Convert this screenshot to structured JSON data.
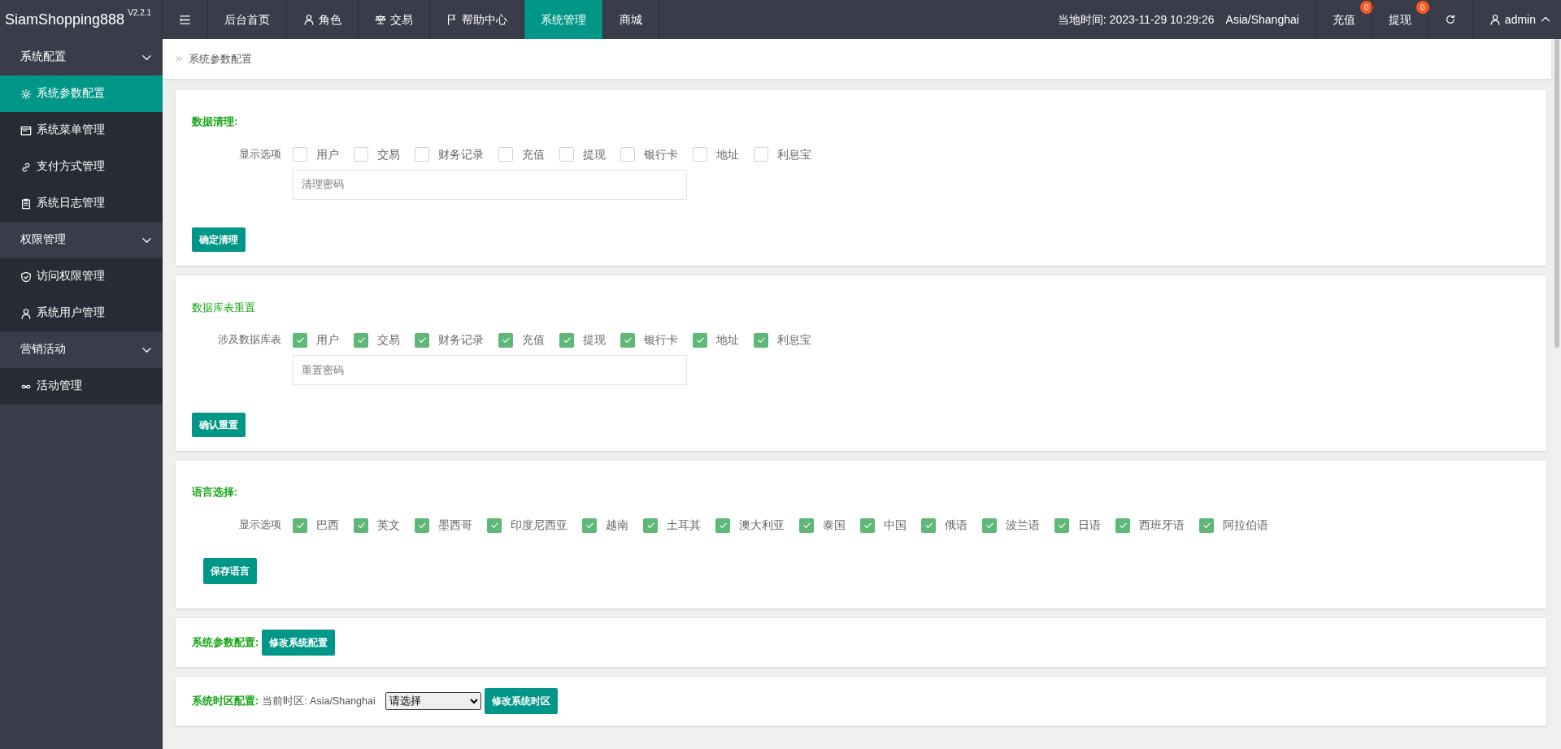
{
  "brand": {
    "name": "SiamShopping888",
    "version": "V2.2.1"
  },
  "top_nav": [
    {
      "label": "后台首页",
      "selected": false
    },
    {
      "label": "角色",
      "selected": false
    },
    {
      "label": "交易",
      "selected": false
    },
    {
      "label": "帮助中心",
      "selected": false
    },
    {
      "label": "系统管理",
      "selected": true
    },
    {
      "label": "商城",
      "selected": false
    }
  ],
  "top_right": {
    "time": "当地时间: 2023-11-29 10:29:26",
    "timezone": "Asia/Shanghai",
    "actions": [
      {
        "label": "充值",
        "badge": "0"
      },
      {
        "label": "提现",
        "badge": "0"
      }
    ],
    "user": "admin"
  },
  "sidebar": [
    {
      "label": "系统配置",
      "expanded": true,
      "children": [
        {
          "label": "系统参数配置",
          "selected": true
        },
        {
          "label": "系统菜单管理",
          "selected": false
        },
        {
          "label": "支付方式管理",
          "selected": false
        },
        {
          "label": "系统日志管理",
          "selected": false
        }
      ]
    },
    {
      "label": "权限管理",
      "expanded": true,
      "children": [
        {
          "label": "访问权限管理",
          "selected": false
        },
        {
          "label": "系统用户管理",
          "selected": false
        }
      ]
    },
    {
      "label": "营销活动",
      "expanded": true,
      "children": [
        {
          "label": "活动管理",
          "selected": false
        }
      ]
    }
  ],
  "breadcrumb": "系统参数配置",
  "sections": [
    {
      "kind": "checks",
      "title": "数据清理:",
      "row_label": "显示选项",
      "options": [
        {
          "label": "用户",
          "checked": false
        },
        {
          "label": "交易",
          "checked": false
        },
        {
          "label": "财务记录",
          "checked": false
        },
        {
          "label": "充值",
          "checked": false
        },
        {
          "label": "提现",
          "checked": false
        },
        {
          "label": "银行卡",
          "checked": false
        },
        {
          "label": "地址",
          "checked": false
        },
        {
          "label": "利息宝",
          "checked": false
        }
      ],
      "placeholder": "清理密码",
      "button": "确定清理"
    },
    {
      "kind": "checks",
      "title": "数据库表重置",
      "row_label": "涉及数据库表",
      "options": [
        {
          "label": "用户",
          "checked": true
        },
        {
          "label": "交易",
          "checked": true
        },
        {
          "label": "财务记录",
          "checked": true
        },
        {
          "label": "充值",
          "checked": true
        },
        {
          "label": "提现",
          "checked": true
        },
        {
          "label": "银行卡",
          "checked": true
        },
        {
          "label": "地址",
          "checked": true
        },
        {
          "label": "利息宝",
          "checked": true
        }
      ],
      "placeholder": "重置密码",
      "button": "确认重置"
    },
    {
      "kind": "checks",
      "title": "语言选择:",
      "row_label": "显示选项",
      "options": [
        {
          "label": "巴西",
          "checked": true
        },
        {
          "label": "英文",
          "checked": true
        },
        {
          "label": "墨西哥",
          "checked": true
        },
        {
          "label": "印度尼西亚",
          "checked": true
        },
        {
          "label": "越南",
          "checked": true
        },
        {
          "label": "土耳其",
          "checked": true
        },
        {
          "label": "澳大利亚",
          "checked": true
        },
        {
          "label": "泰国",
          "checked": true
        },
        {
          "label": "中国",
          "checked": true
        },
        {
          "label": "俄语",
          "checked": true
        },
        {
          "label": "波兰语",
          "checked": true
        },
        {
          "label": "日语",
          "checked": true
        },
        {
          "label": "西班牙语",
          "checked": true
        },
        {
          "label": "阿拉伯语",
          "checked": true
        }
      ],
      "button": "保存语言"
    },
    {
      "kind": "inline",
      "title": "系统参数配置:",
      "button": "修改系统配置"
    },
    {
      "kind": "inline",
      "title": "系统时区配置:",
      "note": "当前时区: Asia/Shanghai",
      "select": "请选择",
      "button": "修改系统时区"
    }
  ]
}
